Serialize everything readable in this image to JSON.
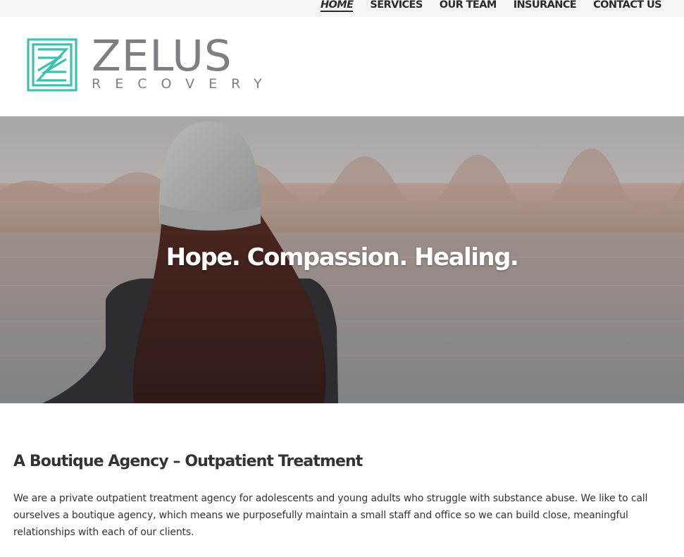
{
  "nav": {
    "items": [
      {
        "label": "HOME",
        "active": true
      },
      {
        "label": "SERVICES",
        "active": false
      },
      {
        "label": "OUR TEAM",
        "active": false
      },
      {
        "label": "INSURANCE",
        "active": false
      },
      {
        "label": "CONTACT US",
        "active": false
      }
    ]
  },
  "logo": {
    "name": "ZELUS",
    "subtitle": "RECOVERY",
    "mark_color": "#3cc1b0",
    "text_color": "#7e7f81"
  },
  "hero": {
    "title": "Hope. Compassion. Healing."
  },
  "section": {
    "heading": "A Boutique Agency – Outpatient Treatment",
    "body": "We are a private outpatient treatment agency for adolescents and young adults who struggle with substance abuse. We like to call ourselves a boutique agency, which means we purposefully maintain a small staff and office so we can build close, meaningful relationships with each of our clients."
  }
}
